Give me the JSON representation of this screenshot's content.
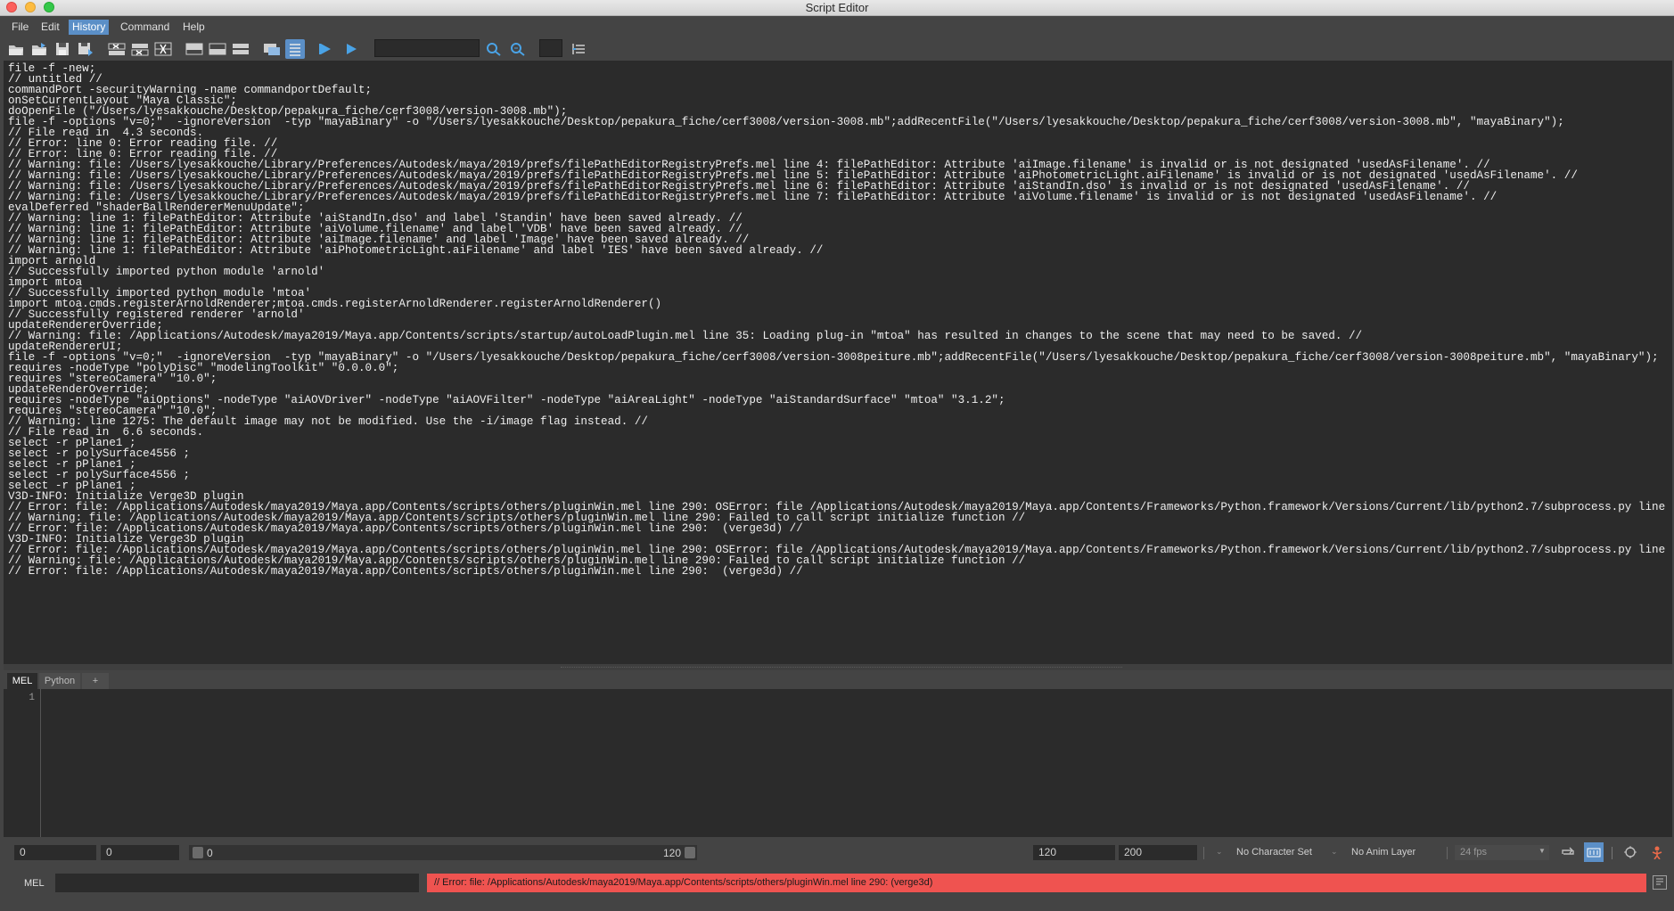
{
  "window": {
    "title": "Script Editor"
  },
  "menu": [
    "File",
    "Edit",
    "History",
    "Command",
    "Help"
  ],
  "toolbar": {
    "search_value": "",
    "icons": [
      "open-script-icon",
      "source-script-icon",
      "save-script-icon",
      "save-script-to-shelf-icon",
      "clear-history-icon",
      "clear-input-icon",
      "clear-all-icon",
      "show-history-icon",
      "show-input-icon",
      "show-both-icon",
      "echo-all-commands-icon",
      "line-numbers-icon",
      "execute-all-icon",
      "execute-icon",
      "search-icon",
      "search-next-icon",
      "goto-line-icon"
    ]
  },
  "history": {
    "lines": [
      "file -f -new;",
      "// untitled //",
      "commandPort -securityWarning -name commandportDefault;",
      "onSetCurrentLayout \"Maya Classic\";",
      "doOpenFile (\"/Users/lyesakkouche/Desktop/pepakura_fiche/cerf3008/version-3008.mb\");",
      "file -f -options \"v=0;\"  -ignoreVersion  -typ \"mayaBinary\" -o \"/Users/lyesakkouche/Desktop/pepakura_fiche/cerf3008/version-3008.mb\";addRecentFile(\"/Users/lyesakkouche/Desktop/pepakura_fiche/cerf3008/version-3008.mb\", \"mayaBinary\");",
      "// File read in  4.3 seconds.",
      "// Error: line 0: Error reading file. //",
      "// Error: line 0: Error reading file. //",
      "// Warning: file: /Users/lyesakkouche/Library/Preferences/Autodesk/maya/2019/prefs/filePathEditorRegistryPrefs.mel line 4: filePathEditor: Attribute 'aiImage.filename' is invalid or is not designated 'usedAsFilename'. //",
      "// Warning: file: /Users/lyesakkouche/Library/Preferences/Autodesk/maya/2019/prefs/filePathEditorRegistryPrefs.mel line 5: filePathEditor: Attribute 'aiPhotometricLight.aiFilename' is invalid or is not designated 'usedAsFilename'. //",
      "// Warning: file: /Users/lyesakkouche/Library/Preferences/Autodesk/maya/2019/prefs/filePathEditorRegistryPrefs.mel line 6: filePathEditor: Attribute 'aiStandIn.dso' is invalid or is not designated 'usedAsFilename'. //",
      "// Warning: file: /Users/lyesakkouche/Library/Preferences/Autodesk/maya/2019/prefs/filePathEditorRegistryPrefs.mel line 7: filePathEditor: Attribute 'aiVolume.filename' is invalid or is not designated 'usedAsFilename'. //",
      "evalDeferred \"shaderBallRendererMenuUpdate\";",
      "// Warning: line 1: filePathEditor: Attribute 'aiStandIn.dso' and label 'Standin' have been saved already. //",
      "// Warning: line 1: filePathEditor: Attribute 'aiVolume.filename' and label 'VDB' have been saved already. //",
      "// Warning: line 1: filePathEditor: Attribute 'aiImage.filename' and label 'Image' have been saved already. //",
      "// Warning: line 1: filePathEditor: Attribute 'aiPhotometricLight.aiFilename' and label 'IES' have been saved already. //",
      "import arnold",
      "// Successfully imported python module 'arnold'",
      "import mtoa",
      "// Successfully imported python module 'mtoa'",
      "import mtoa.cmds.registerArnoldRenderer;mtoa.cmds.registerArnoldRenderer.registerArnoldRenderer()",
      "// Successfully registered renderer 'arnold'",
      "updateRendererOverride;",
      "// Warning: file: /Applications/Autodesk/maya2019/Maya.app/Contents/scripts/startup/autoLoadPlugin.mel line 35: Loading plug-in \"mtoa\" has resulted in changes to the scene that may need to be saved. //",
      "updateRendererUI;",
      "file -f -options \"v=0;\"  -ignoreVersion  -typ \"mayaBinary\" -o \"/Users/lyesakkouche/Desktop/pepakura_fiche/cerf3008/version-3008peiture.mb\";addRecentFile(\"/Users/lyesakkouche/Desktop/pepakura_fiche/cerf3008/version-3008peiture.mb\", \"mayaBinary\");",
      "requires -nodeType \"polyDisc\" \"modelingToolkit\" \"0.0.0.0\";",
      "requires \"stereoCamera\" \"10.0\";",
      "updateRenderOverride;",
      "requires -nodeType \"aiOptions\" -nodeType \"aiAOVDriver\" -nodeType \"aiAOVFilter\" -nodeType \"aiAreaLight\" -nodeType \"aiStandardSurface\" \"mtoa\" \"3.1.2\";",
      "requires \"stereoCamera\" \"10.0\";",
      "// Warning: line 1275: The default image may not be modified. Use the -i/image flag instead. //",
      "// File read in  6.6 seconds.",
      "select -r pPlane1 ;",
      "select -r polySurface4556 ;",
      "select -r pPlane1 ;",
      "select -r polySurface4556 ;",
      "select -r pPlane1 ;",
      "V3D-INFO: Initialize Verge3D plugin",
      "// Error: file: /Applications/Autodesk/maya2019/Maya.app/Contents/scripts/others/pluginWin.mel line 290: OSError: file /Applications/Autodesk/maya2019/Maya.app/Contents/Frameworks/Python.framework/Versions/Current/lib/python2.7/subprocess.py line 1047: 2 //",
      "// Warning: file: /Applications/Autodesk/maya2019/Maya.app/Contents/scripts/others/pluginWin.mel line 290: Failed to call script initialize function //",
      "// Error: file: /Applications/Autodesk/maya2019/Maya.app/Contents/scripts/others/pluginWin.mel line 290:  (verge3d) //",
      "V3D-INFO: Initialize Verge3D plugin",
      "// Error: file: /Applications/Autodesk/maya2019/Maya.app/Contents/scripts/others/pluginWin.mel line 290: OSError: file /Applications/Autodesk/maya2019/Maya.app/Contents/Frameworks/Python.framework/Versions/Current/lib/python2.7/subprocess.py line 1047: 2 //",
      "// Warning: file: /Applications/Autodesk/maya2019/Maya.app/Contents/scripts/others/pluginWin.mel line 290: Failed to call script initialize function //",
      "// Error: file: /Applications/Autodesk/maya2019/Maya.app/Contents/scripts/others/pluginWin.mel line 290:  (verge3d) //"
    ]
  },
  "tabs": [
    "MEL",
    "Python",
    "+"
  ],
  "editor": {
    "line_number": "1"
  },
  "range": {
    "start_time": "0",
    "playback_start": "0",
    "slider_start": "0",
    "slider_end": "120",
    "playback_end": "120",
    "end_time": "200",
    "character_set": "No Character Set",
    "anim_layer": "No Anim Layer",
    "fps": "24 fps"
  },
  "command_line": {
    "language": "MEL",
    "input_value": "",
    "result": "// Error: file: /Applications/Autodesk/maya2019/Maya.app/Contents/scripts/others/pluginWin.mel line 290:  (verge3d)"
  },
  "colors": {
    "panel_bg": "#444444",
    "text_area_bg": "#2b2b2b",
    "menu_highlight": "#5b8fc7",
    "error_bar": "#ef5350"
  }
}
